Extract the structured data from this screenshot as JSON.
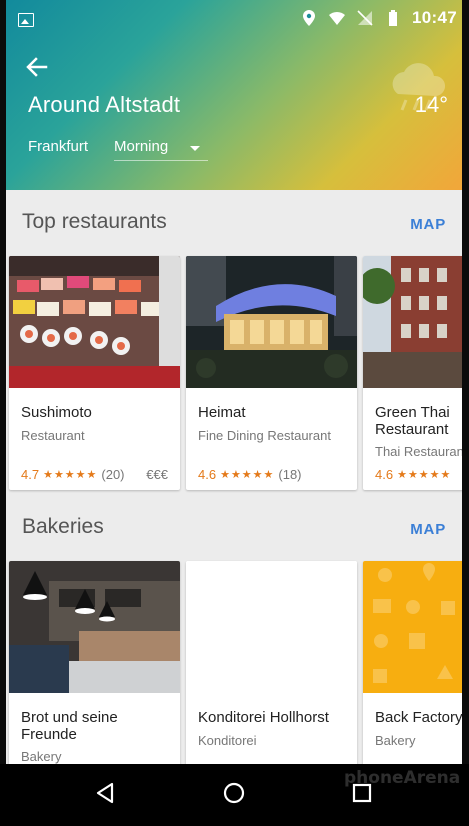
{
  "status_bar": {
    "time": "10:47"
  },
  "header": {
    "title": "Around Altstadt",
    "temperature": "14°",
    "city": "Frankfurt",
    "time_of_day": "Morning"
  },
  "sections": [
    {
      "title": "Top restaurants",
      "map_label": "MAP",
      "cards": [
        {
          "name": "Sushimoto",
          "type": "Restaurant",
          "rating": "4.7",
          "reviews": "(20)",
          "price": "€€€"
        },
        {
          "name": "Heimat",
          "type": "Fine Dining Restaurant",
          "rating": "4.6",
          "reviews": "(18)",
          "price": ""
        },
        {
          "name": "Green Thai Restaurant",
          "type": "Thai Restaurant",
          "rating": "4.6",
          "reviews": "",
          "price": ""
        }
      ]
    },
    {
      "title": "Bakeries",
      "map_label": "MAP",
      "cards": [
        {
          "name": "Brot und seine Freunde",
          "type": "Bakery"
        },
        {
          "name": "Konditorei Hollhorst",
          "type": "Konditorei"
        },
        {
          "name": "Back Factory",
          "type": "Bakery"
        }
      ]
    }
  ],
  "watermark": "phoneArena",
  "colors": {
    "accent_blue": "#3b7fd6",
    "rating_orange": "#e47a1a"
  }
}
